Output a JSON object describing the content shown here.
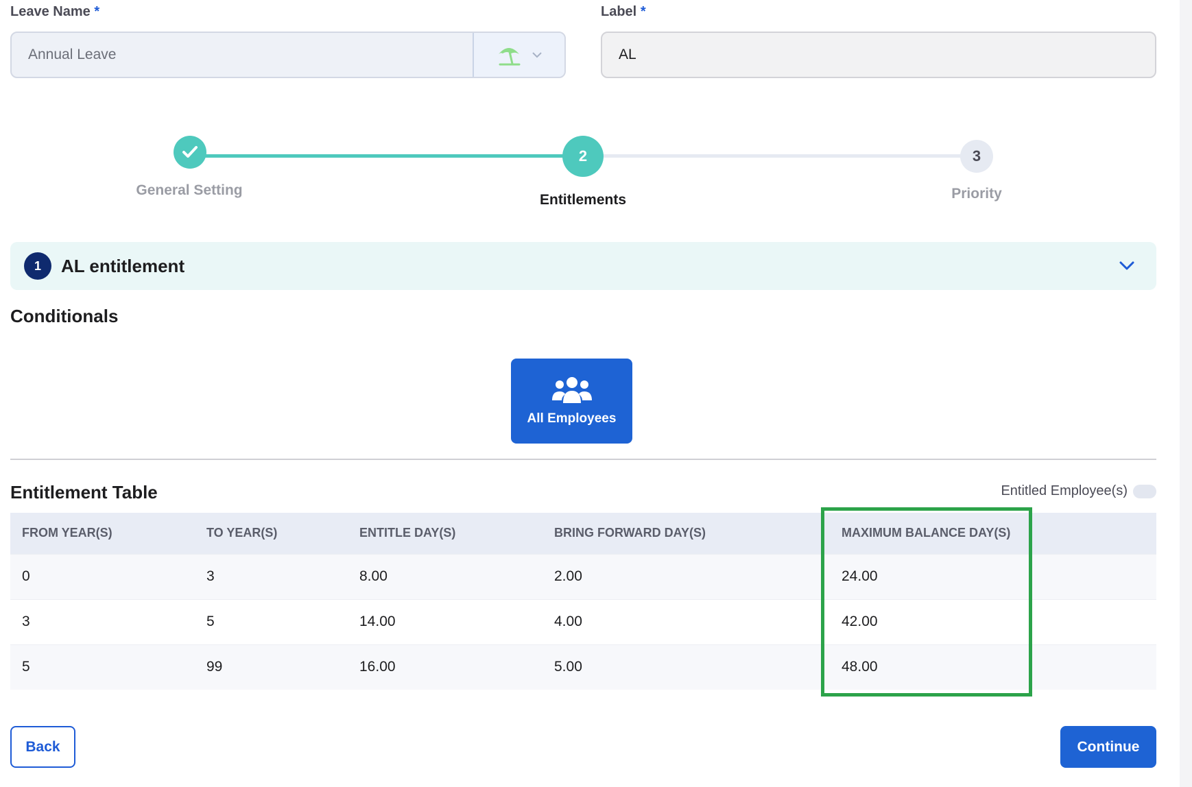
{
  "leave_name": {
    "label": "Leave Name",
    "required_mark": "*",
    "value": "Annual Leave",
    "icon": "beach-umbrella-icon"
  },
  "label_field": {
    "label": "Label",
    "required_mark": "*",
    "value": "AL"
  },
  "stepper": {
    "steps": [
      {
        "number": "1",
        "label": "General Setting",
        "state": "completed"
      },
      {
        "number": "2",
        "label": "Entitlements",
        "state": "active"
      },
      {
        "number": "3",
        "label": "Priority",
        "state": "pending"
      }
    ]
  },
  "entitlement": {
    "number": "1",
    "title": "AL entitlement"
  },
  "conditionals": {
    "title": "Conditionals",
    "button_label": "All Employees",
    "button_icon": "users-icon"
  },
  "table": {
    "title": "Entitlement Table",
    "toggle_label": "Entitled Employee(s)",
    "headers": [
      "FROM YEAR(S)",
      "TO YEAR(S)",
      "ENTITLE DAY(S)",
      "BRING FORWARD DAY(S)",
      "MAXIMUM BALANCE DAY(S)"
    ],
    "rows": [
      [
        "0",
        "3",
        "8.00",
        "2.00",
        "24.00"
      ],
      [
        "3",
        "5",
        "14.00",
        "4.00",
        "42.00"
      ],
      [
        "5",
        "99",
        "16.00",
        "5.00",
        "48.00"
      ]
    ]
  },
  "actions": {
    "back": "Back",
    "continue": "Continue"
  },
  "colors": {
    "accent": "#1e63d4",
    "step_complete": "#4ec9bd",
    "highlight": "#2ca34a",
    "entitlement_badge": "#0f2a6e"
  }
}
